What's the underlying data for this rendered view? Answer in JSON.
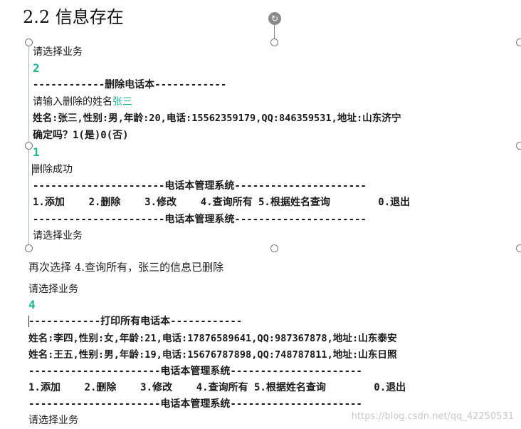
{
  "heading": "2.2 信息存在",
  "console1": {
    "prompt1": "请选择业务",
    "input1": "2",
    "delete_header": "------------删除电话本------------",
    "name_prompt": "请输入删除的姓名",
    "name_input": "张三",
    "record": "姓名:张三,性别:男,年龄:20,电话:15562359179,QQ:846359531,地址:山东济宁",
    "confirm": "确定吗？1(是)0(否)",
    "input2": "1",
    "success": "删除成功",
    "separator_top": "----------------------电话本管理系统----------------------",
    "menu": "1.添加    2.删除    3.修改    4.查询所有 5.根据姓名查询        0.退出",
    "separator_bottom": "----------------------电话本管理系统----------------------",
    "prompt2": "请选择业务"
  },
  "caption": "再次选择 4.查询所有，张三的信息已删除",
  "console2": {
    "prompt1": "请选择业务",
    "input1": "4",
    "print_header": "------------打印所有电话本------------",
    "record1": "姓名:李四,性别:女,年龄:21,电话:17876589641,QQ:987367878,地址:山东泰安",
    "record2": "姓名:王五,性别:男,年龄:19,电话:15676787898,QQ:748787811,地址:山东日照",
    "separator_top": "----------------------电话本管理系统----------------------",
    "menu": "1.添加    2.删除    3.修改    4.查询所有 5.根据姓名查询        0.退出",
    "separator_bottom": "----------------------电话本管理系统----------------------",
    "prompt2": "请选择业务"
  },
  "watermark": "https://blog.csdn.net/qq_42250531",
  "colors": {
    "input_green": "#1ab394",
    "handle_border": "#777777"
  },
  "icons": {
    "rotate": "rotate-handle-icon"
  }
}
